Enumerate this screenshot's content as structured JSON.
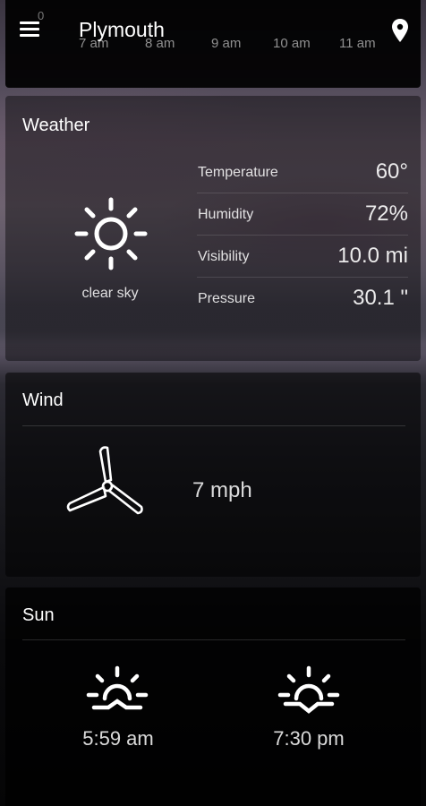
{
  "app_bar": {
    "city": "Plymouth",
    "menu_icon": "hamburger-menu-icon",
    "location_icon": "map-pin-icon"
  },
  "hourly": {
    "top_value": "0",
    "hours": [
      "7 am",
      "8 am",
      "9 am",
      "10 am",
      "11 am"
    ]
  },
  "weather": {
    "title": "Weather",
    "condition": "clear sky",
    "icon": "sun-icon",
    "stats": [
      {
        "label": "Temperature",
        "value": "60°"
      },
      {
        "label": "Humidity",
        "value": "72%"
      },
      {
        "label": "Visibility",
        "value": "10.0 mi"
      },
      {
        "label": "Pressure",
        "value": "30.1 \""
      }
    ]
  },
  "wind": {
    "title": "Wind",
    "speed": "7 mph",
    "icon": "wind-turbine-icon"
  },
  "sun": {
    "title": "Sun",
    "sunrise": "5:59 am",
    "sunset": "7:30 pm",
    "sunrise_icon": "sunrise-icon",
    "sunset_icon": "sunset-icon"
  }
}
